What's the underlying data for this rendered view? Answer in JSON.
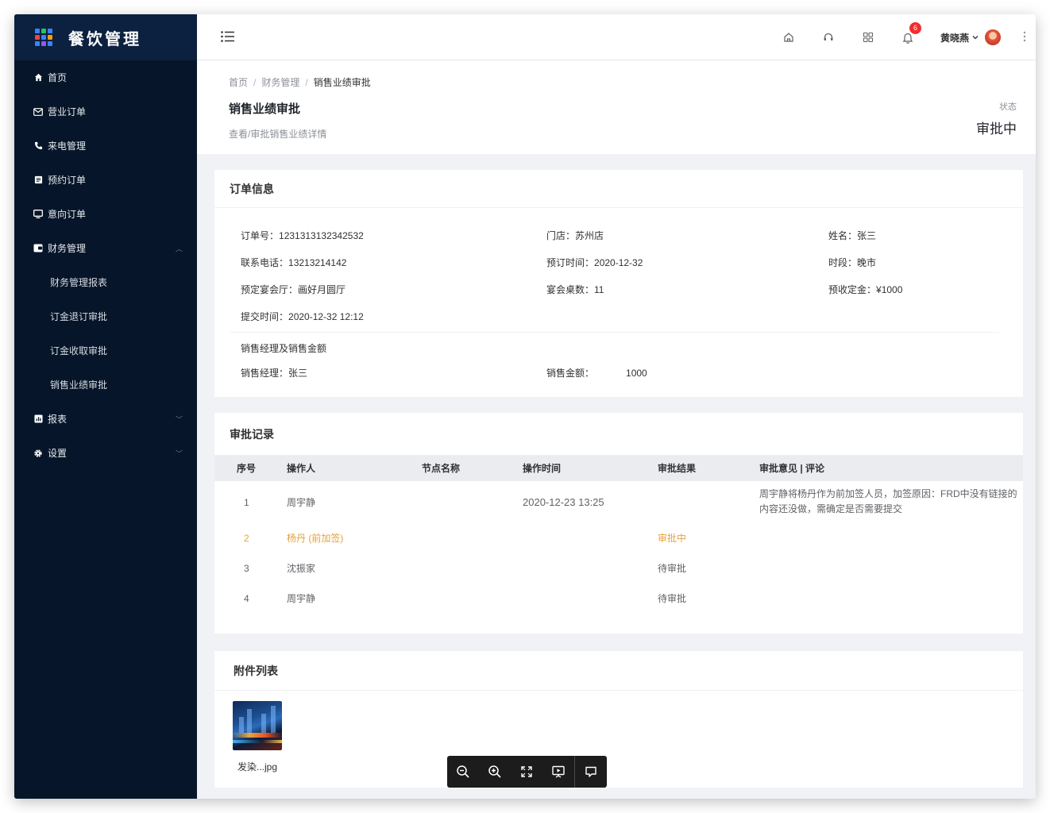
{
  "app": {
    "title": "餐饮管理"
  },
  "sidebar": {
    "items": [
      {
        "label": "首页",
        "icon": "home-icon"
      },
      {
        "label": "营业订单",
        "icon": "mail-icon"
      },
      {
        "label": "来电管理",
        "icon": "phone-icon"
      },
      {
        "label": "预约订单",
        "icon": "list-icon"
      },
      {
        "label": "意向订单",
        "icon": "monitor-icon"
      },
      {
        "label": "财务管理",
        "icon": "wallet-icon",
        "expanded": true
      },
      {
        "label": "财务管理报表",
        "sub": true
      },
      {
        "label": "订金退订审批",
        "sub": true
      },
      {
        "label": "订金收取审批",
        "sub": true
      },
      {
        "label": "销售业绩审批",
        "sub": true
      },
      {
        "label": "报表",
        "icon": "bar-chart-icon",
        "expanded": false
      },
      {
        "label": "设置",
        "icon": "gear-icon",
        "expanded": false
      }
    ]
  },
  "header": {
    "notification_count": "6",
    "user_name": "黄晓燕",
    "icons": [
      "home-icon",
      "headset-icon",
      "apps-icon",
      "bell-icon",
      "more-icon"
    ]
  },
  "breadcrumb": {
    "items": [
      "首页",
      "财务管理",
      "销售业绩审批"
    ],
    "sep": "/"
  },
  "page": {
    "title": "销售业绩审批",
    "subtitle": "查看/审批销售业绩详情",
    "status_label": "状态",
    "status_value": "审批中"
  },
  "order_info": {
    "title": "订单信息",
    "order_no_label": "订单号：",
    "order_no": "1231313132342532",
    "store_label": "门店：",
    "store": "苏州店",
    "name_label": "姓名：",
    "name": "张三",
    "phone_label": "联系电话：",
    "phone": "13213214142",
    "book_time_label": "预订时间：",
    "book_time": "2020-12-32",
    "period_label": "时段：",
    "period": "晚市",
    "hall_label": "预定宴会厅：",
    "hall": "画好月圆厅",
    "tables_label": "宴会桌数：",
    "tables": "11",
    "deposit_label": "预收定金：",
    "deposit": "¥1000",
    "submit_label": "提交时间：",
    "submit_time": "2020-12-32 12:12",
    "section_title": "销售经理及销售金额",
    "manager_label": "销售经理：",
    "manager": "张三",
    "amount_label": "销售金额：",
    "amount": "1000"
  },
  "approval": {
    "title": "审批记录",
    "columns": [
      "序号",
      "操作人",
      "节点名称",
      "操作时间",
      "审批结果",
      "审批意见 | 评论"
    ],
    "rows": [
      {
        "no": "1",
        "operator": "周宇静",
        "node": "",
        "time": "2020-12-23 13:25",
        "result": "",
        "opinion": "周宇静将杨丹作为前加签人员，加签原因：FRD中没有链接的内容还没做，需确定是否需要提交"
      },
      {
        "no": "2",
        "operator": "杨丹 (前加签)",
        "node": "",
        "time": "",
        "result": "审批中",
        "opinion": "",
        "active": true
      },
      {
        "no": "3",
        "operator": "沈振家",
        "node": "",
        "time": "",
        "result": "待审批",
        "opinion": ""
      },
      {
        "no": "4",
        "operator": "周宇静",
        "node": "",
        "time": "",
        "result": "待审批",
        "opinion": ""
      }
    ],
    "active_color": "#e6a23c"
  },
  "attachments": {
    "title": "附件列表",
    "files": [
      {
        "name": "发染...jpg"
      }
    ]
  },
  "viewer_toolbar": {
    "buttons": [
      "zoom-out-icon",
      "zoom-in-icon",
      "fullscreen-icon",
      "slideshow-icon",
      "comment-icon"
    ]
  },
  "colors": {
    "sidebar_bg": "#061529",
    "logo_bg": "#0c2040",
    "accent_warning": "#e6a23c",
    "badge": "#f22d2d"
  }
}
